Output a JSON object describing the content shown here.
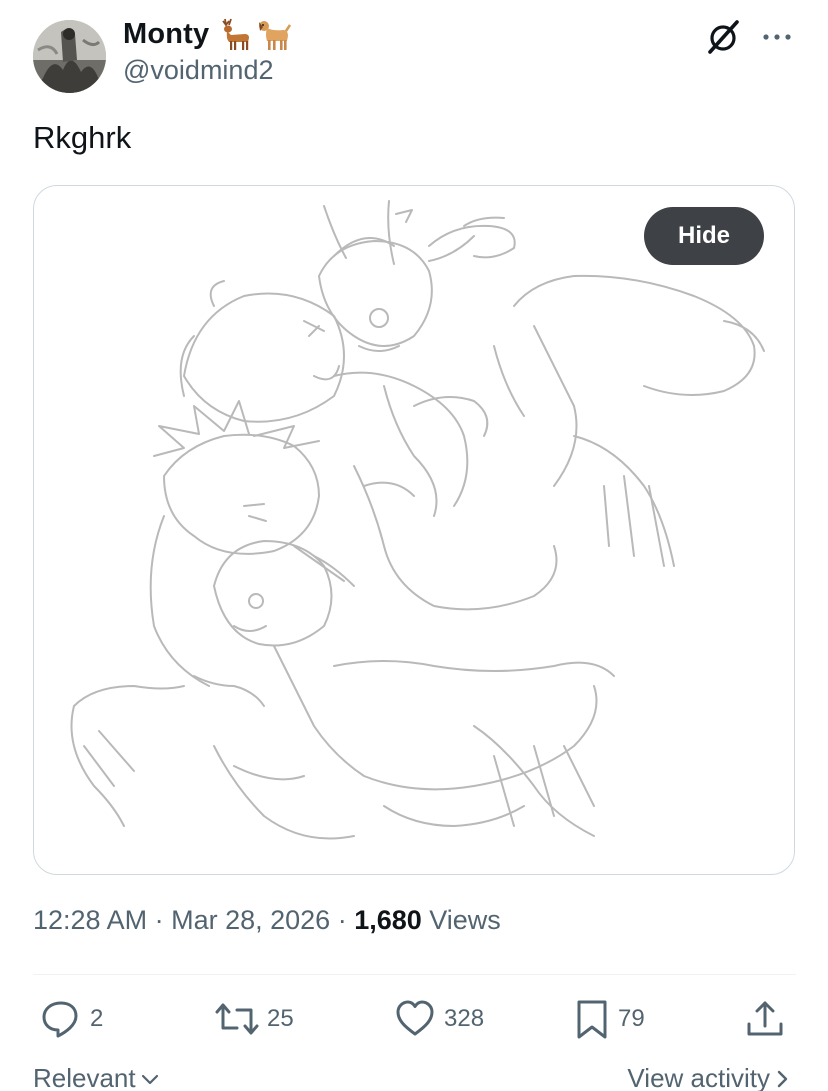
{
  "author": {
    "display_name": "Monty",
    "handle": "@voidmind2",
    "name_emoji": [
      "deer-emoji",
      "dog-emoji"
    ]
  },
  "tweet": {
    "text": "Rkghrk"
  },
  "media": {
    "hide_label": "Hide",
    "kind": "pencil-sketch"
  },
  "meta": {
    "time": "12:28 AM",
    "sep1": " · ",
    "date": "Mar 28, 2026",
    "sep2": " · ",
    "views_count": "1,680",
    "views_label": " Views"
  },
  "actions": {
    "replies": "2",
    "reposts": "25",
    "likes": "328",
    "bookmarks": "79"
  },
  "footer": {
    "relevant_label": "Relevant",
    "view_activity_label": "View activity"
  },
  "colors": {
    "text_primary": "#0f1419",
    "text_secondary": "#536471",
    "hide_button_bg": "#3e4246",
    "border": "#cfd9de"
  },
  "icons": [
    "grok-icon",
    "more-icon",
    "reply-icon",
    "repost-icon",
    "like-icon",
    "bookmark-icon",
    "share-icon",
    "chevron-down-icon",
    "chevron-right-icon"
  ]
}
